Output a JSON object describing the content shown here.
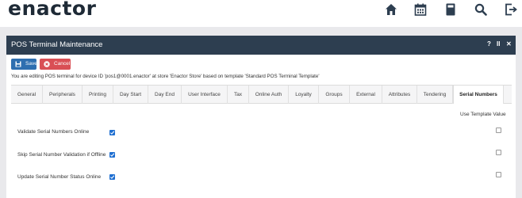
{
  "header": {
    "logo": "enactor",
    "icons": [
      "home-icon",
      "calendar-icon",
      "calculator-icon",
      "search-icon",
      "logout-icon"
    ]
  },
  "panel": {
    "title": "POS Terminal Maintenance",
    "help": "?",
    "pause": "II",
    "close": "✕"
  },
  "toolbar": {
    "save_label": "Save",
    "cancel_label": "Cancel"
  },
  "info_text": "You are editing POS terminal for device ID 'pos1@0001.enactor' at store 'Enactor Store' based on template 'Standard POS Terminal Template'",
  "tabs": [
    "General",
    "Peripherals",
    "Printing",
    "Day Start",
    "Day End",
    "User Interface",
    "Tax",
    "Online Auth",
    "Loyalty",
    "Groups",
    "External",
    "Attributes",
    "Tendering",
    "Serial Numbers"
  ],
  "active_tab": "Serial Numbers",
  "form": {
    "template_column_label": "Use Template Value",
    "rows": [
      {
        "label": "Validate Serial Numbers Online",
        "value": true,
        "use_template": false
      },
      {
        "label": "Skip Serial Number Validation if Offline",
        "value": true,
        "use_template": false
      },
      {
        "label": "Update Serial Number Status Online",
        "value": true,
        "use_template": false
      }
    ]
  },
  "colors": {
    "header_bar": "#2d3e50",
    "save": "#2e6fb0",
    "cancel": "#d94f55",
    "checkbox": "#1f6fd1"
  }
}
